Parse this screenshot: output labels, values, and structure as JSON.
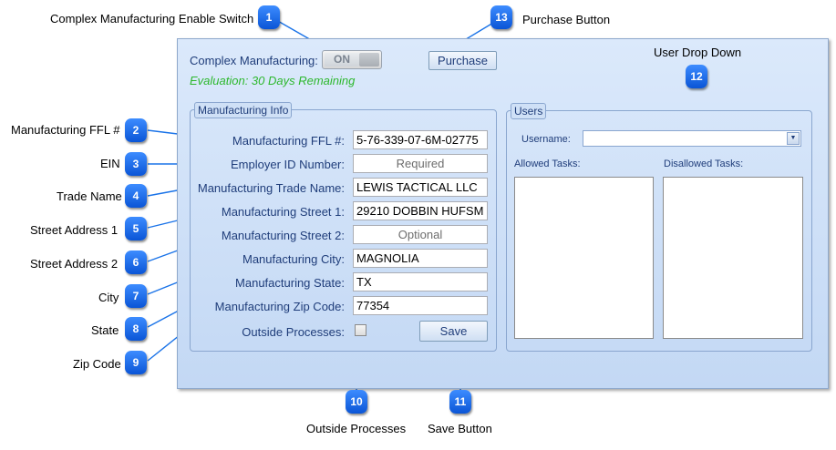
{
  "panel": {
    "complex_manufacturing_label": "Complex Manufacturing:",
    "toggle_state": "ON",
    "evaluation_text": "Evaluation: 30 Days Remaining",
    "purchase_label": "Purchase"
  },
  "manufacturing_info": {
    "title": "Manufacturing Info",
    "fields": [
      {
        "label": "Manufacturing FFL #:",
        "value": "5-76-339-07-6M-02775",
        "placeholder": ""
      },
      {
        "label": "Employer ID Number:",
        "value": "",
        "placeholder": "Required"
      },
      {
        "label": "Manufacturing Trade Name:",
        "value": "LEWIS TACTICAL LLC",
        "placeholder": ""
      },
      {
        "label": "Manufacturing Street 1:",
        "value": "29210 DOBBIN HUFSM",
        "placeholder": ""
      },
      {
        "label": "Manufacturing Street 2:",
        "value": "",
        "placeholder": "Optional"
      },
      {
        "label": "Manufacturing City:",
        "value": "MAGNOLIA",
        "placeholder": ""
      },
      {
        "label": "Manufacturing State:",
        "value": "TX",
        "placeholder": ""
      },
      {
        "label": "Manufacturing Zip Code:",
        "value": "77354",
        "placeholder": ""
      }
    ],
    "outside_processes_label": "Outside Processes:",
    "outside_processes_checked": false,
    "save_label": "Save"
  },
  "users": {
    "title": "Users",
    "username_label": "Username:",
    "username_value": "",
    "allowed_tasks_label": "Allowed Tasks:",
    "disallowed_tasks_label": "Disallowed Tasks:"
  },
  "annotations": [
    {
      "number": "1",
      "text": "Complex Manufacturing Enable Switch"
    },
    {
      "number": "2",
      "text": "Manufacturing FFL #"
    },
    {
      "number": "3",
      "text": "EIN"
    },
    {
      "number": "4",
      "text": "Trade Name"
    },
    {
      "number": "5",
      "text": "Street Address 1"
    },
    {
      "number": "6",
      "text": "Street Address 2"
    },
    {
      "number": "7",
      "text": "City"
    },
    {
      "number": "8",
      "text": "State"
    },
    {
      "number": "9",
      "text": "Zip Code"
    },
    {
      "number": "10",
      "text": "Outside Processes"
    },
    {
      "number": "11",
      "text": "Save Button"
    },
    {
      "number": "12",
      "text": "User Drop Down"
    },
    {
      "number": "13",
      "text": "Purchase Button"
    }
  ],
  "colors": {
    "accent": "#1f3d7a",
    "evaluation": "#2eb82e",
    "badge": "#0a55d6"
  }
}
